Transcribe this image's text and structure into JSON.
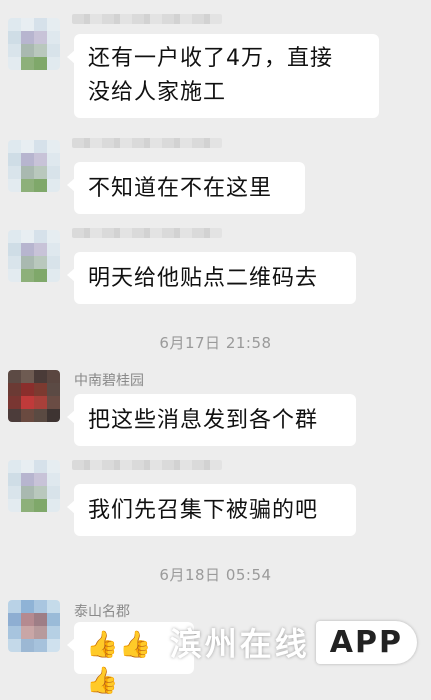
{
  "messages": [
    {
      "text_line1": "还有一户收了4万，直接",
      "text_line2": "没给人家施工"
    },
    {
      "text": "不知道在不在这里"
    },
    {
      "text": "明天给他贴点二维码去"
    },
    {
      "text": "把这些消息发到各个群",
      "sender": "中南碧桂园"
    },
    {
      "text": "我们先召集下被骗的吧"
    },
    {
      "text": "👍👍👍",
      "sender": "泰山名郡"
    }
  ],
  "timestamps": [
    "6月17日 21:58",
    "6月18日 05:54"
  ],
  "watermark": {
    "brand": "滨州在线",
    "app": "APP"
  }
}
